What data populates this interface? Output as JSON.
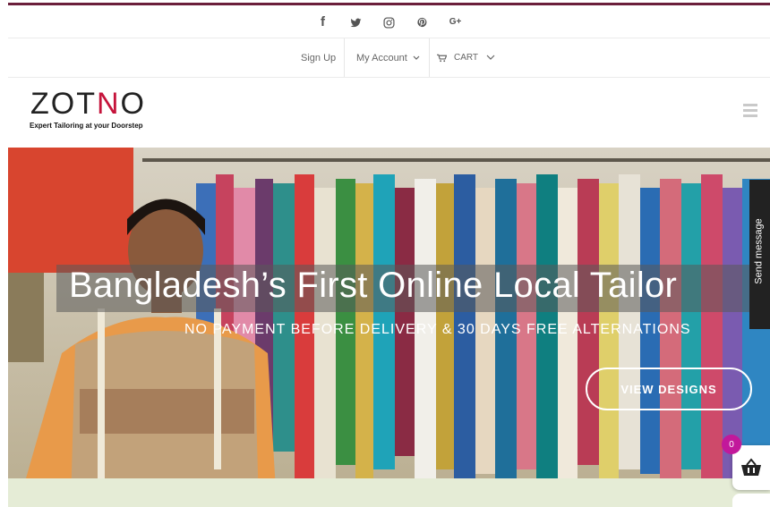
{
  "social": {
    "icons": [
      "facebook-icon",
      "twitter-icon",
      "instagram-icon",
      "pinterest-icon",
      "google-plus-icon"
    ],
    "glyphs": {
      "facebook": "f",
      "google_plus": "G+"
    }
  },
  "account_bar": {
    "sign_up": "Sign Up",
    "my_account": "My Account",
    "cart": "CART"
  },
  "logo": {
    "text_left": "ZOT",
    "text_n": "N",
    "text_right": "O",
    "tagline": "Expert Tailoring at your Doorstep",
    "accent_color": "#c5143b"
  },
  "hero": {
    "title": "Bangladesh’s First Online Local Tailor",
    "subtitle": "NO PAYMENT BEFORE DELIVERY & 30 DAYS FREE ALTERNATIONS",
    "button": "VIEW DESIGNS"
  },
  "side_tab": {
    "label": "Send message"
  },
  "cart_widget": {
    "count": "0",
    "badge_color": "#c2189b"
  },
  "colors": {
    "top_border": "#6b1f3b"
  }
}
